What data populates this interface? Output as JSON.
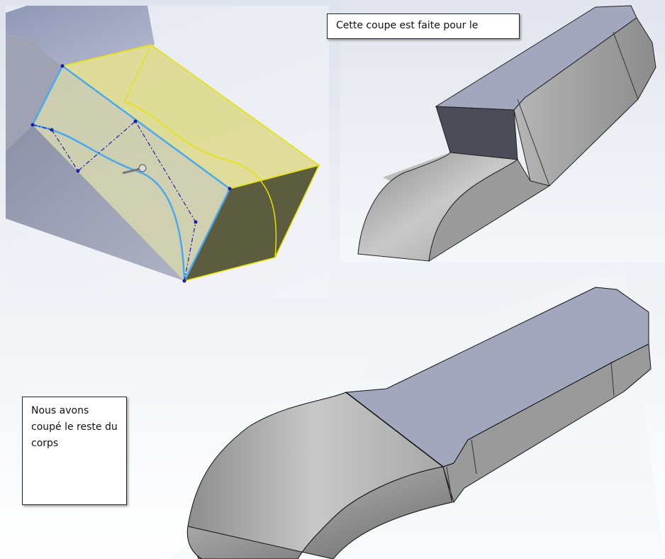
{
  "callouts": {
    "top": "Cette coupe est faite pour le",
    "bottom": "Nous avons coupé le reste du corps"
  },
  "colors": {
    "top_face": "#a2a7bd",
    "side_face": "#9a9a9a",
    "sketch_highlight": "#e4e27a",
    "edge_blue": "#49a8ee",
    "sketch_dash": "#1c1ca8"
  }
}
